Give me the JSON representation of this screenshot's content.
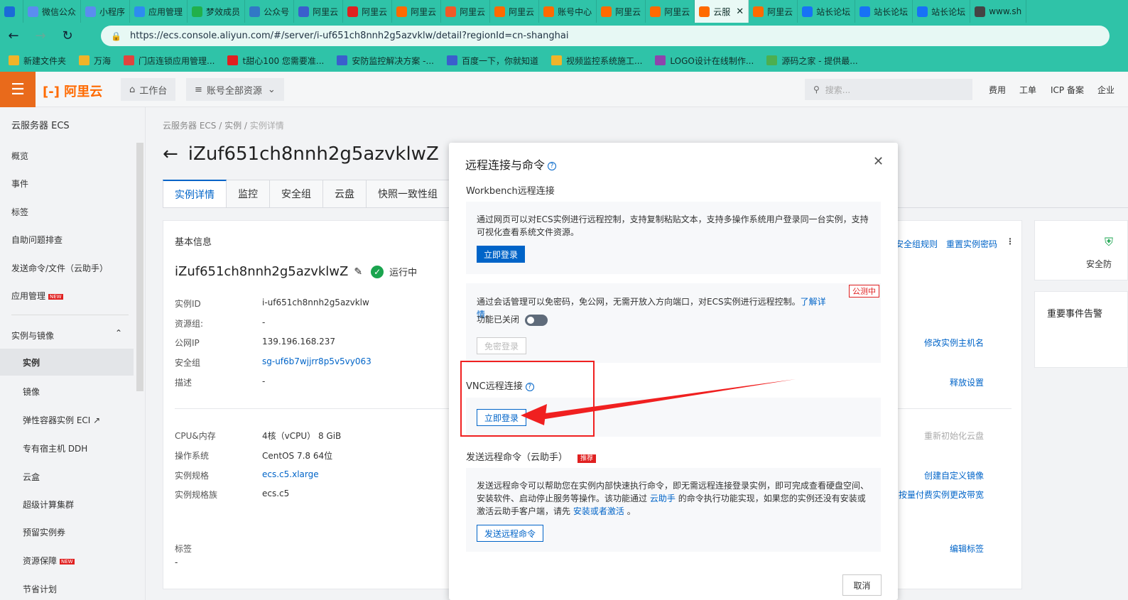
{
  "browser": {
    "tabs": [
      {
        "label": "",
        "color": "#1a6bd8",
        "icon": "tab-list-icon"
      },
      {
        "label": "微信公众",
        "color": "#5b8def"
      },
      {
        "label": "小程序",
        "color": "#5b8def"
      },
      {
        "label": "应用管理",
        "color": "#2d8cf0"
      },
      {
        "label": "梦效成员",
        "color": "#21b04b"
      },
      {
        "label": "公众号",
        "color": "#3178c6"
      },
      {
        "label": "阿里云",
        "color": "#3a5fcd"
      },
      {
        "label": "阿里云",
        "color": "#e02020"
      },
      {
        "label": "阿里云",
        "color": "#ff6a00"
      },
      {
        "label": "阿里云",
        "color": "#f05a28"
      },
      {
        "label": "阿里云",
        "color": "#ff6a00"
      },
      {
        "label": "账号中心",
        "color": "#ff6a00"
      },
      {
        "label": "阿里云",
        "color": "#ff6a00"
      },
      {
        "label": "阿里云",
        "color": "#ff6a00"
      },
      {
        "label": "云服",
        "color": "#ff6a00",
        "active": true
      },
      {
        "label": "阿里云",
        "color": "#ff6a00"
      },
      {
        "label": "站长论坛",
        "color": "#1772f6"
      },
      {
        "label": "站长论坛",
        "color": "#1772f6"
      },
      {
        "label": "站长论坛",
        "color": "#1772f6"
      },
      {
        "label": "www.sh",
        "color": "#444444"
      }
    ],
    "url": "https://ecs.console.aliyun.com/#/server/i-uf651ch8nnh2g5azvklw/detail?regionId=cn-shanghai",
    "bookmarks": [
      {
        "label": "新建文件夹",
        "color": "#f0b429"
      },
      {
        "label": "万海",
        "color": "#f0b429"
      },
      {
        "label": "门店连锁应用管理...",
        "color": "#e0443e"
      },
      {
        "label": "t甜心100 您需要准...",
        "color": "#e02020"
      },
      {
        "label": "安防监控解决方案 -...",
        "color": "#3a5fcd"
      },
      {
        "label": "百度一下，你就知道",
        "color": "#3a5fcd"
      },
      {
        "label": "视频监控系统施工...",
        "color": "#f0b429"
      },
      {
        "label": "LOGO设计在线制作...",
        "color": "#8e44ad"
      },
      {
        "label": "源码之家 - 提供最...",
        "color": "#4caf50"
      }
    ]
  },
  "header": {
    "logo": "阿里云",
    "workbench": "工作台",
    "resources": "账号全部资源",
    "search_placeholder": "搜索...",
    "links": [
      "费用",
      "工单",
      "ICP 备案",
      "企业"
    ]
  },
  "sidebar": {
    "title": "云服务器 ECS",
    "items": [
      "概览",
      "事件",
      "标签",
      "自助问题排查",
      "发送命令/文件（云助手）",
      "应用管理"
    ],
    "group": "实例与镜像",
    "subitems": [
      "实例",
      "镜像",
      "弹性容器实例 ECI",
      "专有宿主机 DDH",
      "云盒",
      "超级计算集群",
      "预留实例券",
      "资源保障",
      "节省计划"
    ],
    "new_badge": "NEW"
  },
  "page": {
    "breadcrumb": [
      "云服务器 ECS",
      "实例",
      "实例详情"
    ],
    "title": "iZuf651ch8nnh2g5azvklwZ",
    "tabs": [
      "实例详情",
      "监控",
      "安全组",
      "云盘",
      "快照一致性组"
    ],
    "basic_info": "基本信息",
    "instance_name": "iZuf651ch8nnh2g5azvklwZ",
    "status": "运行中",
    "fields": [
      {
        "label": "实例ID",
        "value": "i-uf651ch8nnh2g5azvklw"
      },
      {
        "label": "资源组:",
        "value": "-"
      },
      {
        "label": "公网IP",
        "value": "139.196.168.237"
      },
      {
        "label": "安全组",
        "value": "sg-uf6b7wjjrr8p5v5vy063"
      },
      {
        "label": "描述",
        "value": "-"
      },
      {
        "label": "CPU&内存",
        "value": "4核（vCPU） 8 GiB"
      },
      {
        "label": "操作系统",
        "value": "CentOS 7.8 64位"
      },
      {
        "label": "实例规格",
        "value": "ecs.c5.xlarge"
      },
      {
        "label": "实例规格族",
        "value": "ecs.c5"
      },
      {
        "label": "标签",
        "value": "-"
      }
    ],
    "right_links": [
      "安全组规则",
      "重置实例密码",
      "修改实例主机名",
      "释放设置",
      "重新初始化云盘",
      "创建自定义镜像",
      "按量付费实例更改带宽",
      "编辑标签"
    ],
    "right_cards": {
      "security": "安全防",
      "events": "重要事件告警"
    }
  },
  "modal": {
    "title": "远程连接与命令",
    "workbench_header": "Workbench远程连接",
    "workbench_desc": "通过网页可以对ECS实例进行远程控制，支持复制粘贴文本，支持多操作系统用户登录同一台实例，支持可视化查看系统文件资源。",
    "login_btn": "立即登录",
    "session_desc": "通过会话管理可以免密码，免公网，无需开放入方向端口，对ECS实例进行远程控制。",
    "learn_more": "了解详情",
    "beta": "公测中",
    "toggle_label": "功能已关闭",
    "pwdless_btn": "免密登录",
    "vnc_header": "VNC远程连接",
    "vnc_btn": "立即登录",
    "cmd_header": "发送远程命令（云助手）",
    "recommend": "推荐",
    "cmd_desc_1": "发送远程命令可以帮助您在实例内部快速执行命令，即无需远程连接登录实例，即可完成查看硬盘空间、安装软件、启动停止服务等操作。该功能通过",
    "cmd_link_1": "云助手",
    "cmd_desc_2": "的命令执行功能实现，如果您的实例还没有安装或激活云助手客户端，请先",
    "cmd_link_2": "安装或者激活",
    "cmd_desc_3": "。",
    "cmd_btn": "发送远程命令",
    "cancel": "取消"
  },
  "colors": {
    "accent": "#0064c8",
    "browser_chrome": "#2fc3a8",
    "annotation": "#f02020",
    "brand": "#ff6a00"
  }
}
